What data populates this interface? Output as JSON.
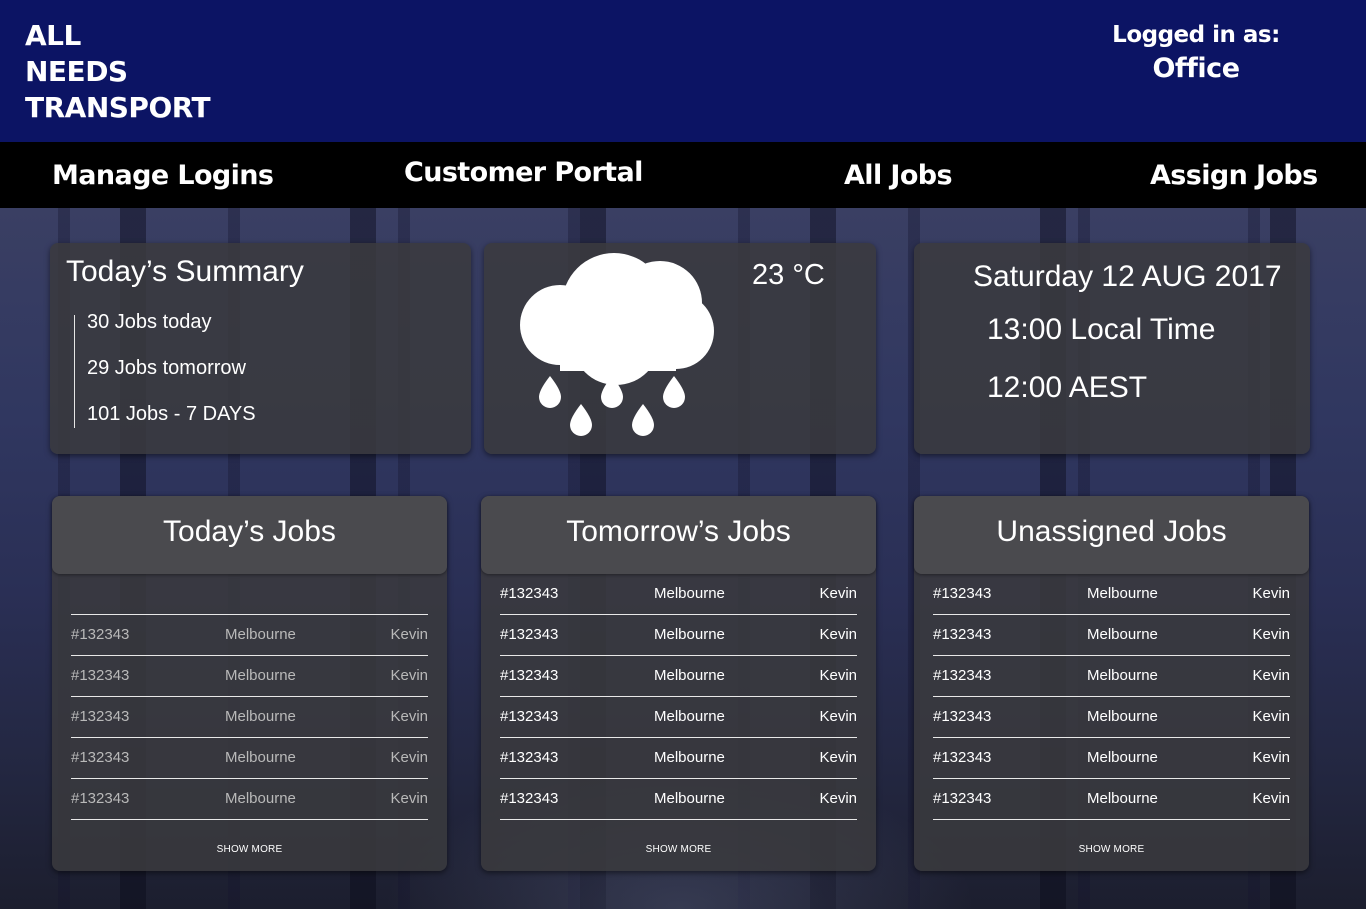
{
  "brand": {
    "line1": "ALL",
    "line2": "NEEDS",
    "line3": "TRANSPORT"
  },
  "login": {
    "label": "Logged in as:",
    "user": "Office"
  },
  "nav": {
    "manage_logins": "Manage Logins",
    "customer_portal": "Customer Portal",
    "all_jobs": "All Jobs",
    "assign_jobs": "Assign Jobs"
  },
  "summary": {
    "title": "Today’s Summary",
    "items": [
      "30 Jobs today",
      "29 Jobs tomorrow",
      "101 Jobs - 7 DAYS"
    ]
  },
  "weather": {
    "icon": "rain-cloud-icon",
    "temperature": "23 °C"
  },
  "datetime": {
    "date": "Saturday 12 AUG 2017",
    "local_time": "13:00 Local Time",
    "aest_time": "12:00 AEST"
  },
  "todays_jobs": {
    "title": "Today’s Jobs",
    "rows": [
      {
        "id": "#132343",
        "city": "Melbourne",
        "name": "Kevin"
      },
      {
        "id": "#132343",
        "city": "Melbourne",
        "name": "Kevin"
      },
      {
        "id": "#132343",
        "city": "Melbourne",
        "name": "Kevin"
      },
      {
        "id": "#132343",
        "city": "Melbourne",
        "name": "Kevin"
      },
      {
        "id": "#132343",
        "city": "Melbourne",
        "name": "Kevin"
      }
    ],
    "show_more": "SHOW MORE"
  },
  "tomorrows_jobs": {
    "title": "Tomorrow’s Jobs",
    "rows": [
      {
        "id": "#132343",
        "city": "Melbourne",
        "name": "Kevin"
      },
      {
        "id": "#132343",
        "city": "Melbourne",
        "name": "Kevin"
      },
      {
        "id": "#132343",
        "city": "Melbourne",
        "name": "Kevin"
      },
      {
        "id": "#132343",
        "city": "Melbourne",
        "name": "Kevin"
      },
      {
        "id": "#132343",
        "city": "Melbourne",
        "name": "Kevin"
      },
      {
        "id": "#132343",
        "city": "Melbourne",
        "name": "Kevin"
      }
    ],
    "show_more": "SHOW MORE"
  },
  "unassigned_jobs": {
    "title": "Unassigned Jobs",
    "rows": [
      {
        "id": "#132343",
        "city": "Melbourne",
        "name": "Kevin"
      },
      {
        "id": "#132343",
        "city": "Melbourne",
        "name": "Kevin"
      },
      {
        "id": "#132343",
        "city": "Melbourne",
        "name": "Kevin"
      },
      {
        "id": "#132343",
        "city": "Melbourne",
        "name": "Kevin"
      },
      {
        "id": "#132343",
        "city": "Melbourne",
        "name": "Kevin"
      },
      {
        "id": "#132343",
        "city": "Melbourne",
        "name": "Kevin"
      }
    ],
    "show_more": "SHOW MORE"
  },
  "colors": {
    "header_bg": "#0c1464",
    "nav_bg": "#000000",
    "panel_bg": "#3a3a3e"
  }
}
